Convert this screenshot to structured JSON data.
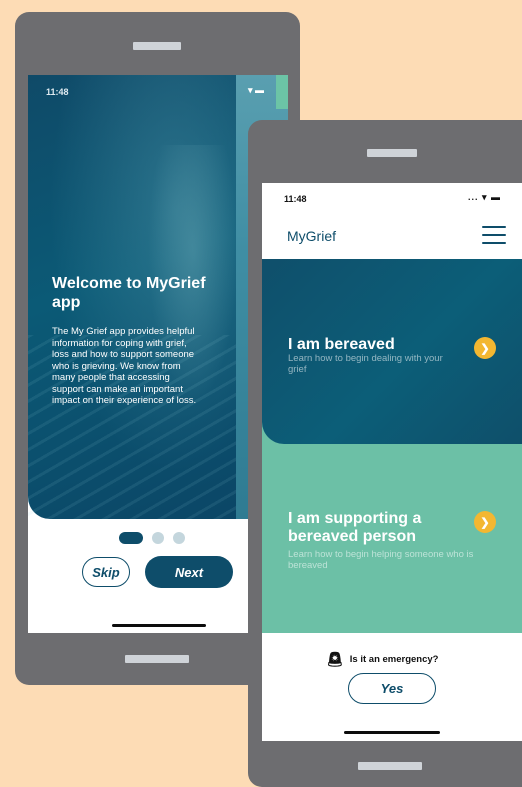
{
  "onboarding": {
    "status_time": "11:48",
    "status_icons": "▾ ▬",
    "welcome_title": "Welcome to MyGrief app",
    "welcome_body": "The My Grief app provides helpful information for coping with grief, loss and how to support someone who is grieving. We know from many people that accessing support can make an important impact on their experience of loss.",
    "page_count": 3,
    "active_page": 1,
    "skip_label": "Skip",
    "next_label": "Next"
  },
  "home": {
    "status_time": "11:48",
    "status_icons": "... ▾ ▬",
    "app_title": "MyGrief",
    "menu_icon": "hamburger-menu-icon",
    "cards": [
      {
        "title": "I am bereaved",
        "subtitle": "Learn how to begin dealing with your grief",
        "icon": "chevron-right-icon"
      },
      {
        "title": "I am supporting a bereaved person",
        "subtitle": "Learn how to begin helping someone who is bereaved",
        "icon": "chevron-right-icon"
      }
    ],
    "emergency_question": "Is it an emergency?",
    "emergency_icon": "siren-icon",
    "yes_label": "Yes"
  },
  "colors": {
    "background": "#fddcb5",
    "device": "#6d6d70",
    "brand_blue": "#0e4d6a",
    "green": "#6cc0a6",
    "accent_yellow": "#f3b731"
  }
}
